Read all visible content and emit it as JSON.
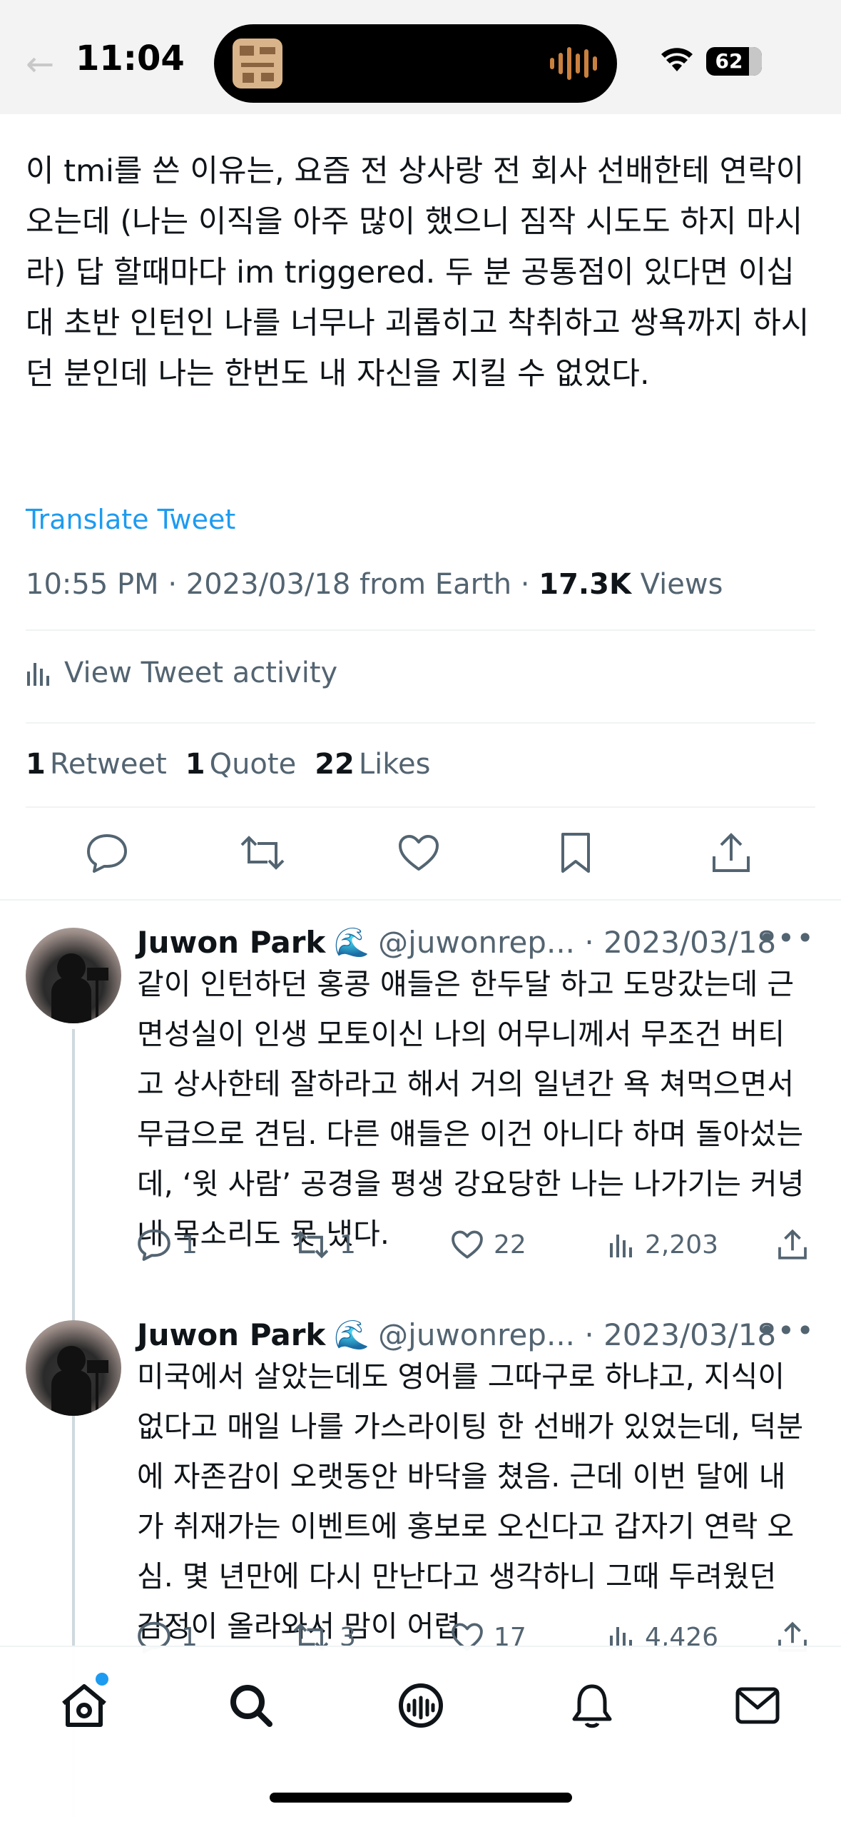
{
  "status_bar": {
    "time": "11:04",
    "battery": "62"
  },
  "tweet": {
    "text": "이 tmi를 쓴 이유는, 요즘 전 상사랑 전 회사 선배한테 연락이 오는데 (나는 이직을 아주 많이 했으니 짐작 시도도 하지 마시라) 답 할때마다 im triggered. 두 분 공통점이 있다면 이십대 초반 인턴인 나를 너무나 괴롭히고 착취하고 쌍욕까지 하시던 분인데 나는 한번도 내 자신을 지킬 수 없었다.",
    "translate_label": "Translate Tweet",
    "timestamp": "10:55 PM · 2023/03/18 from Earth · ",
    "views_count": "17.3K",
    "views_label": "Views",
    "activity_label": "View Tweet activity",
    "retweets_count": "1",
    "retweets_label": "Retweet",
    "quotes_count": "1",
    "quotes_label": "Quote",
    "likes_count": "22",
    "likes_label": "Likes"
  },
  "replies": [
    {
      "name": "Juwon Park",
      "emoji": "🌊",
      "handle": "@juwonrep... · 2023/03/18",
      "text": "같이 인턴하던 홍콩 얘들은 한두달 하고 도망갔는데 근면성실이 인생 모토이신 나의 어무니께서 무조건 버티고 상사한테 잘하라고 해서 거의 일년간 욕 쳐먹으면서 무급으로 견딤. 다른 얘들은 이건 아니다 하며 돌아섰는데, ‘윗 사람’ 공경을 평생 강요당한 나는 나가기는 커녕 내 목소리도 못 냈다.",
      "replies": "1",
      "retweets": "1",
      "likes": "22",
      "views": "2,203"
    },
    {
      "name": "Juwon Park",
      "emoji": "🌊",
      "handle": "@juwonrep... · 2023/03/18",
      "text": "미국에서 살았는데도 영어를 그따구로 하냐고, 지식이 없다고 매일 나를 가스라이팅 한 선배가 있었는데, 덕분에 자존감이 오랫동안 바닥을 쳤음. 근데 이번 달에 내가 취재가는 이벤트에 홍보로 오신다고 갑자기 연락 오심. 몇 년만에 다시 만난다고 생각하니 그때 두려웠던 감정이 올라와서 맘이 어렵",
      "replies": "1",
      "retweets": "3",
      "likes": "17",
      "views": "4,426"
    }
  ],
  "tabbar": {
    "icons": [
      "home-icon",
      "search-icon",
      "spaces-icon",
      "notifications-icon",
      "messages-icon"
    ]
  }
}
